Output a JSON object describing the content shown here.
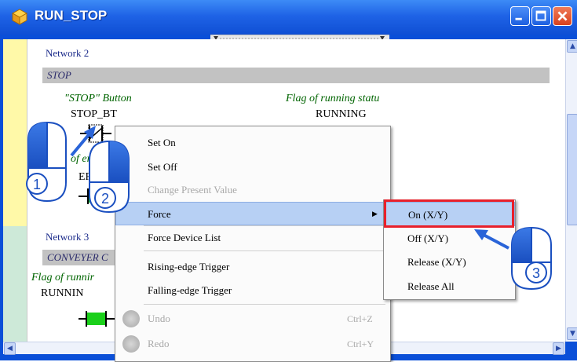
{
  "window": {
    "title": "RUN_STOP"
  },
  "ladder": {
    "network2_label": "Network 2",
    "network2_comment": "STOP",
    "contact_comment": "\"STOP\" Button",
    "contact_name": "STOP_BT",
    "coil_comment": "Flag of running statu",
    "coil_name": "RUNNING",
    "partial_comment_left": "of err",
    "partial_name_left": "ER",
    "network3_label": "Network 3",
    "network3_comment": "CONVEYER C",
    "network3_flag_comment": "Flag of runnir",
    "network3_name": "RUNNIN"
  },
  "context_menu": {
    "items": [
      {
        "label": "Set On",
        "enabled": true
      },
      {
        "label": "Set Off",
        "enabled": true
      },
      {
        "label": "Change Present Value",
        "enabled": false
      },
      {
        "label": "Force",
        "enabled": true,
        "highlighted": true,
        "has_submenu": true
      },
      {
        "label": "Force Device List",
        "enabled": true
      },
      {
        "label": "Rising-edge Trigger",
        "enabled": true
      },
      {
        "label": "Falling-edge Trigger",
        "enabled": true
      },
      {
        "label": "Undo",
        "enabled": false,
        "shortcut": "Ctrl+Z"
      },
      {
        "label": "Redo",
        "enabled": false,
        "shortcut": "Ctrl+Y"
      }
    ]
  },
  "submenu": {
    "items": [
      {
        "label": "On (X/Y)",
        "highlighted": true
      },
      {
        "label": "Off (X/Y)"
      },
      {
        "label": "Release (X/Y)"
      },
      {
        "label": "Release All"
      }
    ]
  },
  "annotations": {
    "step1": "1",
    "step2": "2",
    "step3": "3"
  },
  "colors": {
    "titlebar": "#1f63e6",
    "highlight": "#b7d0f4",
    "callout_red": "#e8202a",
    "pointer_blue": "#2a64d8",
    "coil_green": "#1bd01b"
  }
}
